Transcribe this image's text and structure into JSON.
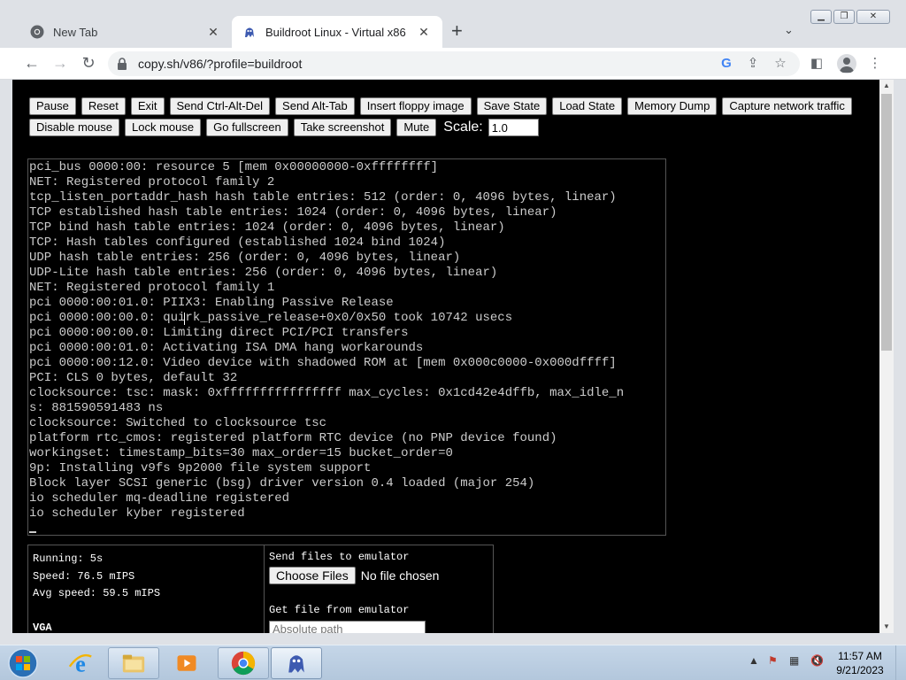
{
  "browser": {
    "tabs": [
      {
        "title": "New Tab",
        "icon": "chrome-icon"
      },
      {
        "title": "Buildroot Linux - Virtual x86",
        "icon": "v86-icon"
      }
    ],
    "address": "copy.sh/v86/?profile=buildroot",
    "new_tab_symbol": "+"
  },
  "emulator": {
    "buttons_row1": [
      "Pause",
      "Reset",
      "Exit",
      "Send Ctrl-Alt-Del",
      "Send Alt-Tab",
      "Insert floppy image",
      "Save State",
      "Load State",
      "Memory Dump",
      "Capture network traffic"
    ],
    "buttons_row2": [
      "Disable mouse",
      "Lock mouse",
      "Go fullscreen",
      "Take screenshot",
      "Mute"
    ],
    "scale_label": "Scale:",
    "scale_value": "1.0",
    "terminal_lines": [
      "pci_bus 0000:00: resource 5 [mem 0x00000000-0xffffffff]",
      "NET: Registered protocol family 2",
      "tcp_listen_portaddr_hash hash table entries: 512 (order: 0, 4096 bytes, linear)",
      "TCP established hash table entries: 1024 (order: 0, 4096 bytes, linear)",
      "TCP bind hash table entries: 1024 (order: 0, 4096 bytes, linear)",
      "TCP: Hash tables configured (established 1024 bind 1024)",
      "UDP hash table entries: 256 (order: 0, 4096 bytes, linear)",
      "UDP-Lite hash table entries: 256 (order: 0, 4096 bytes, linear)",
      "NET: Registered protocol family 1",
      "pci 0000:00:01.0: PIIX3: Enabling Passive Release",
      "pci 0000:00:00.0: quirk_passive_release+0x0/0x50 took 10742 usecs",
      "pci 0000:00:00.0: Limiting direct PCI/PCI transfers",
      "pci 0000:00:01.0: Activating ISA DMA hang workarounds",
      "pci 0000:00:12.0: Video device with shadowed ROM at [mem 0x000c0000-0x000dffff]",
      "PCI: CLS 0 bytes, default 32",
      "clocksource: tsc: mask: 0xffffffffffffffff max_cycles: 0x1cd42e4dffb, max_idle_n",
      "s: 881590591483 ns",
      "clocksource: Switched to clocksource tsc",
      "platform rtc_cmos: registered platform RTC device (no PNP device found)",
      "workingset: timestamp_bits=30 max_order=15 bucket_order=0",
      "9p: Installing v9fs 9p2000 file system support",
      "Block layer SCSI generic (bsg) driver version 0.4 loaded (major 254)",
      "io scheduler mq-deadline registered",
      "io scheduler kyber registered"
    ],
    "status": {
      "running": "Running: 5s",
      "speed": "Speed: 76.5 mIPS",
      "avg_speed": "Avg speed: 59.5 mIPS",
      "vga": "VGA"
    },
    "files": {
      "send_label": "Send files to emulator",
      "choose_button": "Choose Files",
      "no_file": "No file chosen",
      "get_label": "Get file from emulator",
      "path_placeholder": "Absolute path"
    }
  },
  "taskbar": {
    "apps": [
      "start-orb-icon",
      "internet-explorer-icon",
      "file-explorer-icon",
      "media-player-icon",
      "chrome-icon",
      "v86-icon"
    ],
    "time": "11:57 AM",
    "date": "9/21/2023"
  },
  "colors": {
    "page_bg": "#000000",
    "terminal_text": "#cccccc",
    "taskbar": "#b3c7dc"
  }
}
